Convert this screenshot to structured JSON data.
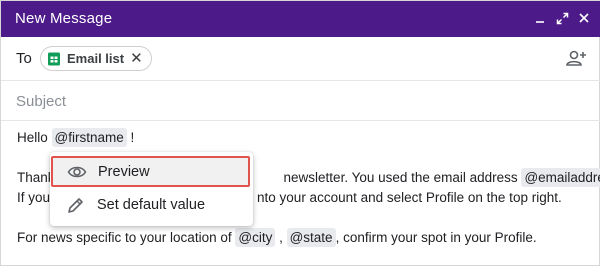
{
  "window": {
    "title": "New Message"
  },
  "to": {
    "label": "To",
    "chip": {
      "label": "Email list",
      "close": "✕"
    }
  },
  "subject": {
    "placeholder": "Subject",
    "value": ""
  },
  "body": {
    "line1": {
      "pre": "Hello ",
      "tag": "@firstname",
      "post": " !"
    },
    "line2": {
      "pre": "Thank",
      "mid": "newsletter. You used the email address ",
      "tag": "@emailaddress",
      "post": " ."
    },
    "line3": {
      "pre": "If you",
      "post": "nto your account and select Profile on the top right."
    },
    "line4": {
      "pre": "For news specific to your location of ",
      "tag1": "@city",
      "sep": " , ",
      "tag2": "@state",
      "post": ", confirm your spot in your Profile."
    }
  },
  "context_menu": {
    "items": [
      {
        "label": "Preview",
        "icon": "eye-icon"
      },
      {
        "label": "Set default value",
        "icon": "pencil-icon"
      }
    ]
  },
  "colors": {
    "titlebar": "#4d1a8a",
    "highlight_border": "#e0544d",
    "tag_bg": "#e8eaed",
    "sheets_green": "#0f9d58"
  }
}
